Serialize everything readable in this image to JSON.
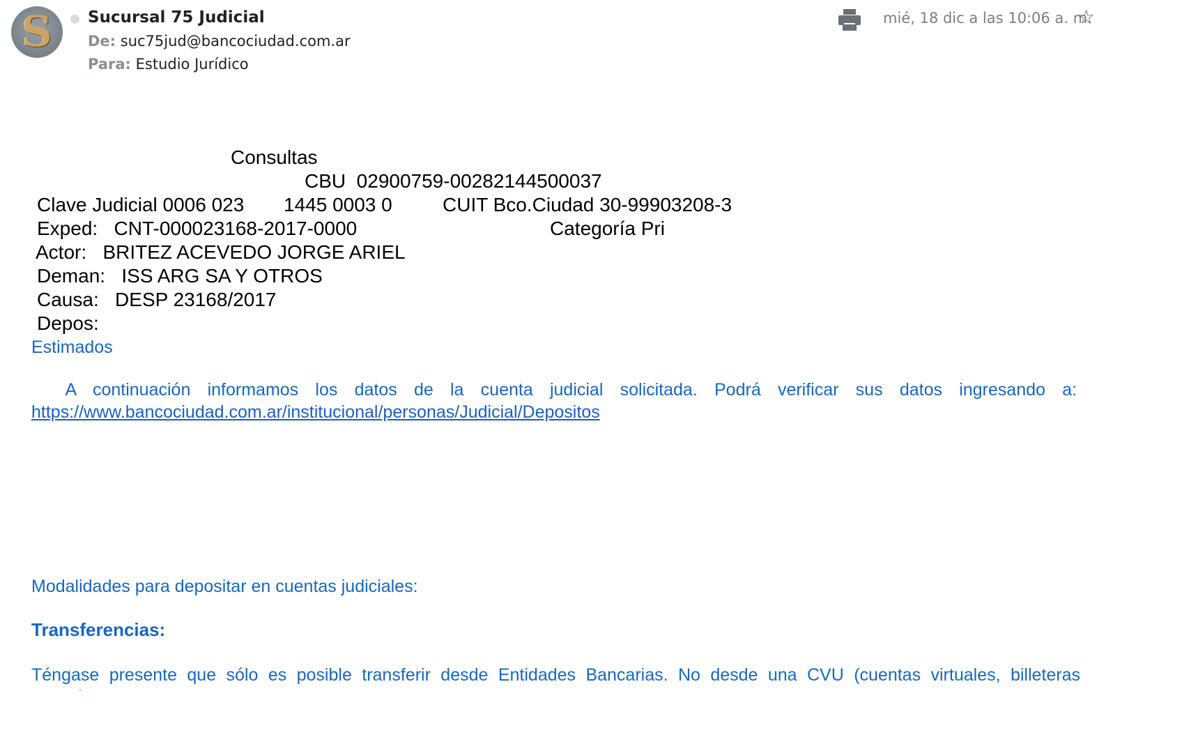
{
  "header": {
    "avatar_letter": "S",
    "sender_name": "Sucursal 75 Judicial",
    "from_label": "De:",
    "from_value": "suc75jud@bancociudad.com.ar",
    "to_label": "Para:",
    "to_value": "Estudio Jurídico",
    "date": "mié, 18 dic a las 10:06 a. m.",
    "print_icon": "print-icon",
    "star_icon": "star-icon"
  },
  "record": {
    "title": "Consultas",
    "cbu_line": "CBU  02900759-00282144500037",
    "clave_line": "Clave Judicial 0006 023",
    "clave_num": "1445 0003 0",
    "cuit": "CUIT Bco.Ciudad 30-99903208-3",
    "exped_line": "Exped:   CNT-000023168-2017-0000",
    "categoria": "Categoría Pri",
    "actor_line": "Actor:   BRITEZ ACEVEDO JORGE ARIEL",
    "deman_line": "Deman:   ISS ARG SA Y OTROS",
    "causa_line": "Causa:   DESP 23168/2017",
    "depos_line": "Depos:"
  },
  "message": {
    "greeting": "Estimados",
    "intro": "A continuación informamos los datos de la cuenta judicial solicitada. Podrá verificar sus datos ingresando a:",
    "link": "https://www.bancociudad.com.ar/institucional/personas/Judicial/Depositos",
    "modalidades": "Modalidades para depositar en cuentas judiciales:",
    "transferencias": "Transferencias:",
    "note": "Téngase presente que sólo es posible transferir desde Entidades Bancarias. No desde una CVU (cuentas virtuales, billeteras electrónicas, etc)."
  },
  "colors": {
    "blue_text": "#1867c0",
    "meta_gray": "#8a8f94"
  }
}
